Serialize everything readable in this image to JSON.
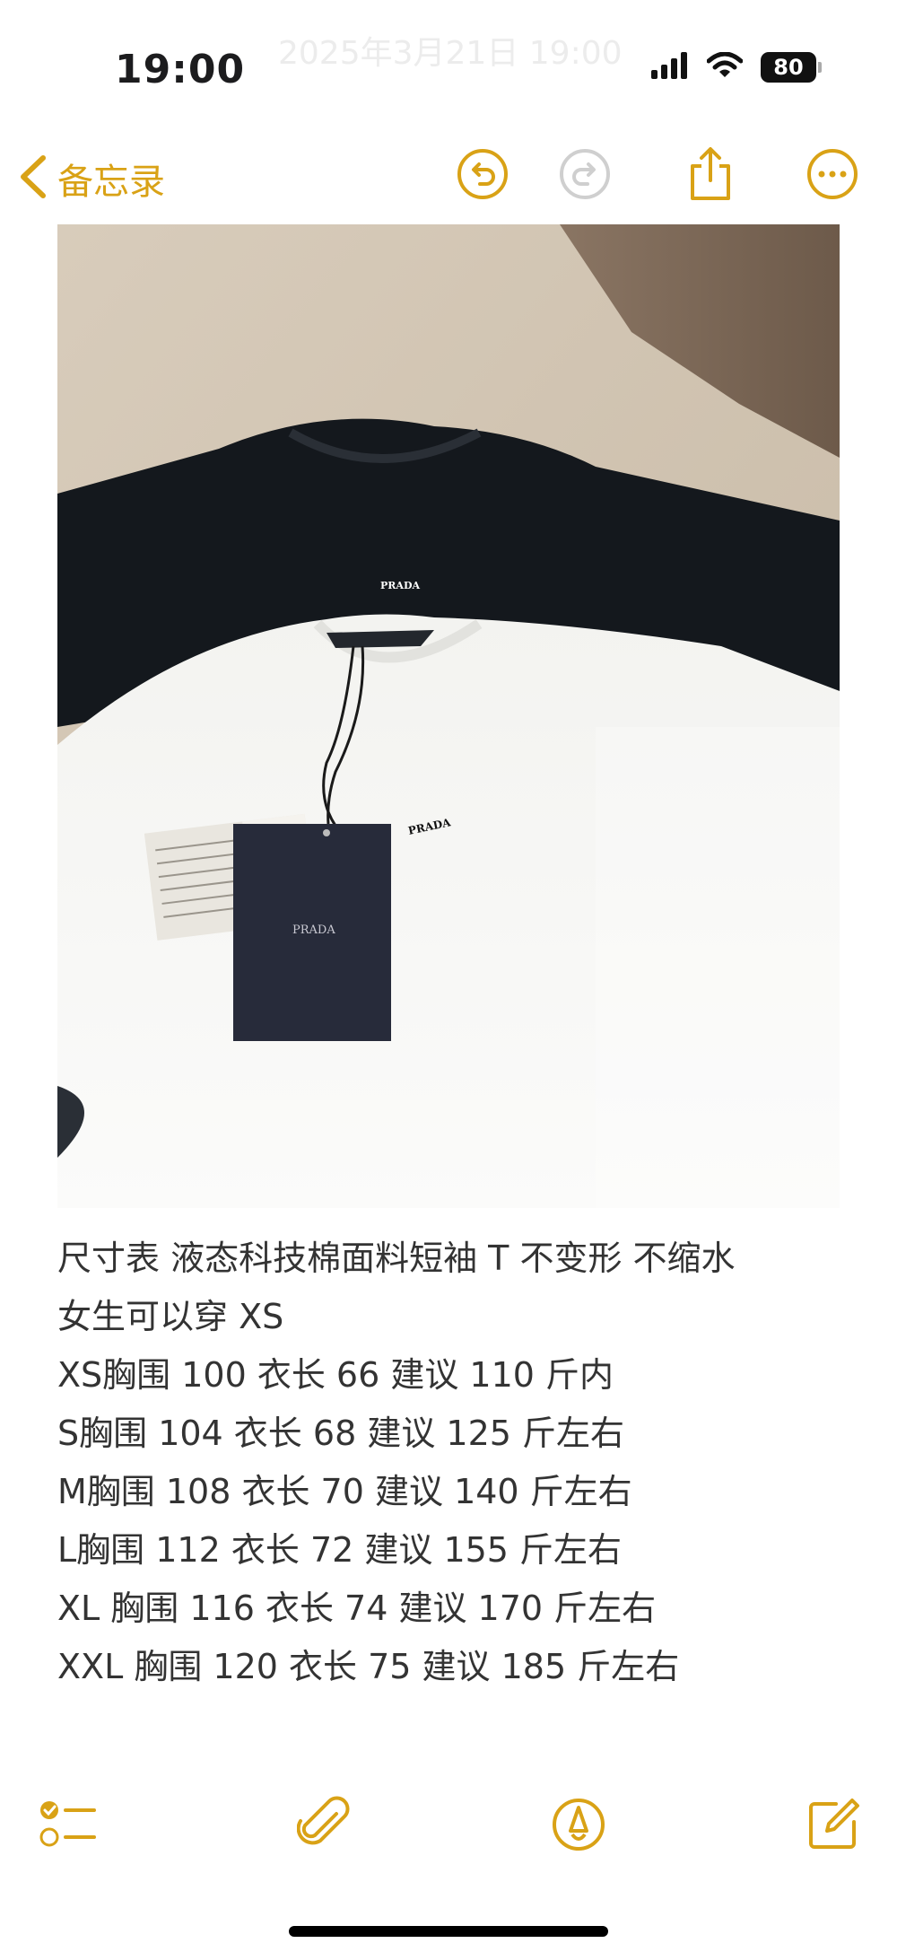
{
  "status_bar": {
    "time": "19:00",
    "date_overlay": "2025年3月21日 19:00",
    "battery": "80",
    "icons": [
      "cellular-signal-icon",
      "wifi-icon",
      "battery-icon"
    ]
  },
  "nav": {
    "back_label": "备忘录",
    "icons": [
      "chevron-left-icon",
      "undo-icon",
      "redo-icon",
      "share-icon",
      "more-icon"
    ]
  },
  "image": {
    "black_shirt_logo": "PRADA",
    "white_shirt_logo": "PRADA",
    "hang_tag_logo": "PRADA"
  },
  "note": {
    "lines": [
      "尺寸表  液态科技棉面料短袖 T 不变形 不缩水",
      "女生可以穿 XS",
      "XS胸围 100 衣长 66 建议 110 斤内",
      "S胸围 104 衣长 68 建议 125 斤左右",
      "M胸围 108 衣长 70 建议 140 斤左右",
      "L胸围 112 衣长 72 建议 155 斤左右",
      "XL 胸围 116 衣长 74 建议 170 斤左右",
      "XXL 胸围 120 衣长 75 建议 185 斤左右"
    ]
  },
  "toolbar": {
    "icons": [
      "checklist-icon",
      "paperclip-icon",
      "markup-pen-icon",
      "compose-icon"
    ]
  },
  "colors": {
    "accent": "#d9a216",
    "text": "#333333",
    "background": "#ffffff"
  }
}
